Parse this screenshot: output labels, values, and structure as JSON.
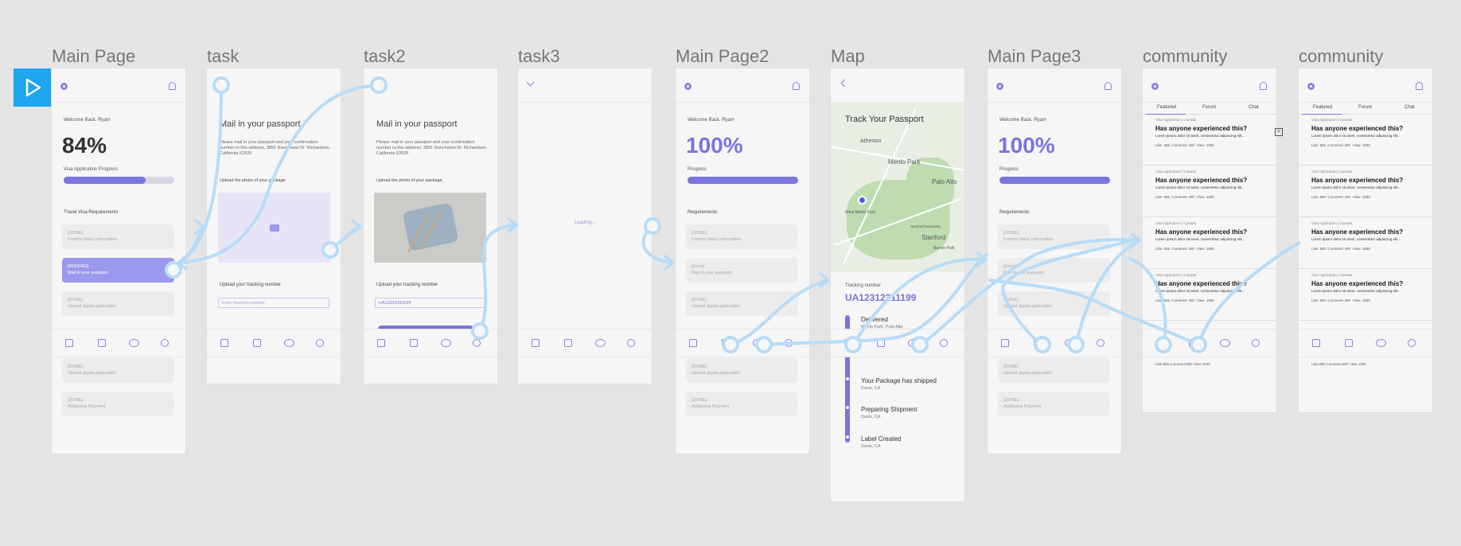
{
  "frames": {
    "main": "Main Page",
    "task": "task",
    "task2": "task2",
    "task3": "task3",
    "main2": "Main Page2",
    "map": "Map",
    "main3": "Main Page3",
    "community1": "community",
    "community2": "community"
  },
  "icons": [
    "play-icon",
    "gear-icon",
    "bell-icon",
    "camera-icon",
    "chevron-down-icon",
    "chevron-left-icon",
    "home-icon",
    "chart-icon",
    "community-icon",
    "profile-icon"
  ],
  "colors": {
    "accent": "#7b74dd",
    "flow": "#b7dcf8",
    "play": "#1ea5f0",
    "missing": "#9c98ee"
  },
  "main": {
    "welcome": "Welcome Back, Ryan!",
    "percent": "84%",
    "progress_label": "Visa Application Progress",
    "progress_value": 0.74,
    "requirements_title": "Travel Visa Requirements",
    "items": [
      {
        "status": "[DONE]",
        "name": "Confirm basic information"
      },
      {
        "status": "[MISSING]",
        "name": "Mail in your passport"
      },
      {
        "status": "[DONE]",
        "name": "Upload digital application"
      },
      {
        "status": "[DONE]",
        "name": "Upload digital application"
      },
      {
        "status": "[DONE]",
        "name": "Additional Payment"
      }
    ]
  },
  "task": {
    "heading": "Mail in your passport",
    "body": "Please mail in your passport and your confirmation number to this address, 3891 Ranchview Dr. Richardson, California 62639",
    "upload_label": "Upload the photo of your package.",
    "tracking_label": "Upload your tracking number",
    "tracking_placeholder": "Enter tracking number"
  },
  "task2": {
    "heading": "Mail in your passport",
    "body": "Please mail in your passport and your confirmation number to this address, 3891 Ranchview Dr. Richardson, California 62639",
    "upload_label": "Upload the photo of your package.",
    "tracking_label": "Upload your tracking number",
    "tracking_value": "UA12312311199"
  },
  "task3": {
    "loading": "Loading..."
  },
  "main2": {
    "welcome": "Welcome Back, Ryan!",
    "percent": "100%",
    "progress_label": "Progress",
    "progress_value": 1.0,
    "requirements_title": "Requirements",
    "items": [
      {
        "status": "[DONE]",
        "name": "Confirm basic information"
      },
      {
        "status": "[Done]",
        "name": "Mail in your passport"
      },
      {
        "status": "[DONE]",
        "name": "Upload digital application"
      },
      {
        "status": "[DONE]",
        "name": "Upload digital application"
      },
      {
        "status": "[DONE]",
        "name": "Additional Payment"
      }
    ]
  },
  "map": {
    "title": "Track Your Passport",
    "places": [
      "Atherton",
      "Menlo Park",
      "Palo Alto",
      "West Menlo Park",
      "Stanford",
      "Stanford University",
      "Barron Park"
    ],
    "tracking_label": "Tracking number",
    "tracking_number": "UA12312311199",
    "timeline": [
      {
        "title": "Delivered",
        "sub": "Menlo Park, Palo Alto"
      },
      {
        "title": "Your Package has shipped",
        "sub": "Davis, CA"
      },
      {
        "title": "Preparing Shipment",
        "sub": "Davis, CA"
      },
      {
        "title": "Label Created",
        "sub": "Davis, CA"
      }
    ]
  },
  "main3": {
    "welcome": "Welcome Back, Ryan!",
    "percent": "100%",
    "progress_label": "Progress",
    "progress_value": 1.0,
    "requirements_title": "Requirements",
    "items": [
      {
        "status": "[DONE]",
        "name": "Confirm basic information"
      },
      {
        "status": "[Done]",
        "name": "Mail in your passport"
      },
      {
        "status": "[DONE]",
        "name": "Upload digital application"
      },
      {
        "status": "[DONE]",
        "name": "Upload digital application"
      },
      {
        "status": "[DONE]",
        "name": "Additional Payment"
      }
    ]
  },
  "community": {
    "tabs": [
      "Featured",
      "Forum",
      "Chat"
    ],
    "posts": [
      {
        "category": "Visa Application | Canada",
        "question": "Has anyone experienced this?",
        "body": "Lorem ipsum dolor sit amet, consectetur adipiscing elit...",
        "meta": "Like  555     Comment  887     View  1000"
      },
      {
        "category": "Visa Application | Canada",
        "question": "Has anyone experienced this?",
        "body": "Lorem ipsum dolor sit amet, consectetur adipiscing elit...",
        "meta": "Like  555     Comment  887     View  1000"
      },
      {
        "category": "Visa Application | Canada",
        "question": "Has anyone experienced this?",
        "body": "Lorem ipsum dolor sit amet, consectetur adipiscing elit...",
        "meta": "Like  555     Comment  887     View  1000"
      },
      {
        "category": "Visa Application | Canada",
        "question": "Has anyone experienced this?",
        "body": "Lorem ipsum dolor sit amet, consectetur adipiscing elit...",
        "meta": "Like  555     Comment  887     View  1000"
      }
    ],
    "last_meta": "Like  555     Comment  887     View  1000"
  }
}
